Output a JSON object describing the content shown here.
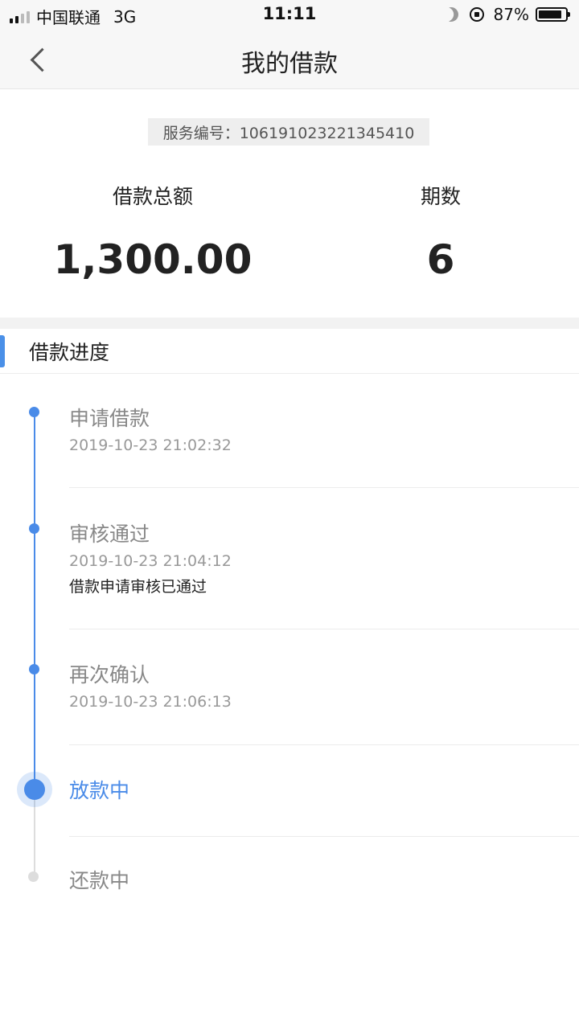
{
  "status_bar": {
    "carrier": "中国联通",
    "network": "3G",
    "time": "11:11",
    "battery": "87%"
  },
  "nav": {
    "title": "我的借款"
  },
  "summary": {
    "service_no": "服务编号：106191023221345410",
    "total_label": "借款总额",
    "total_value": "1,300.00",
    "periods_label": "期数",
    "periods_value": "6"
  },
  "progress": {
    "title": "借款进度",
    "steps": [
      {
        "title": "申请借款",
        "time": "2019-10-23 21:02:32",
        "note": ""
      },
      {
        "title": "审核通过",
        "time": "2019-10-23 21:04:12",
        "note": "借款申请审核已通过"
      },
      {
        "title": "再次确认",
        "time": "2019-10-23 21:06:13",
        "note": ""
      },
      {
        "title": "放款中",
        "time": "",
        "note": ""
      },
      {
        "title": "还款中",
        "time": "",
        "note": ""
      }
    ]
  },
  "colors": {
    "accent": "#4a8be8",
    "inactive": "#dddddd"
  }
}
